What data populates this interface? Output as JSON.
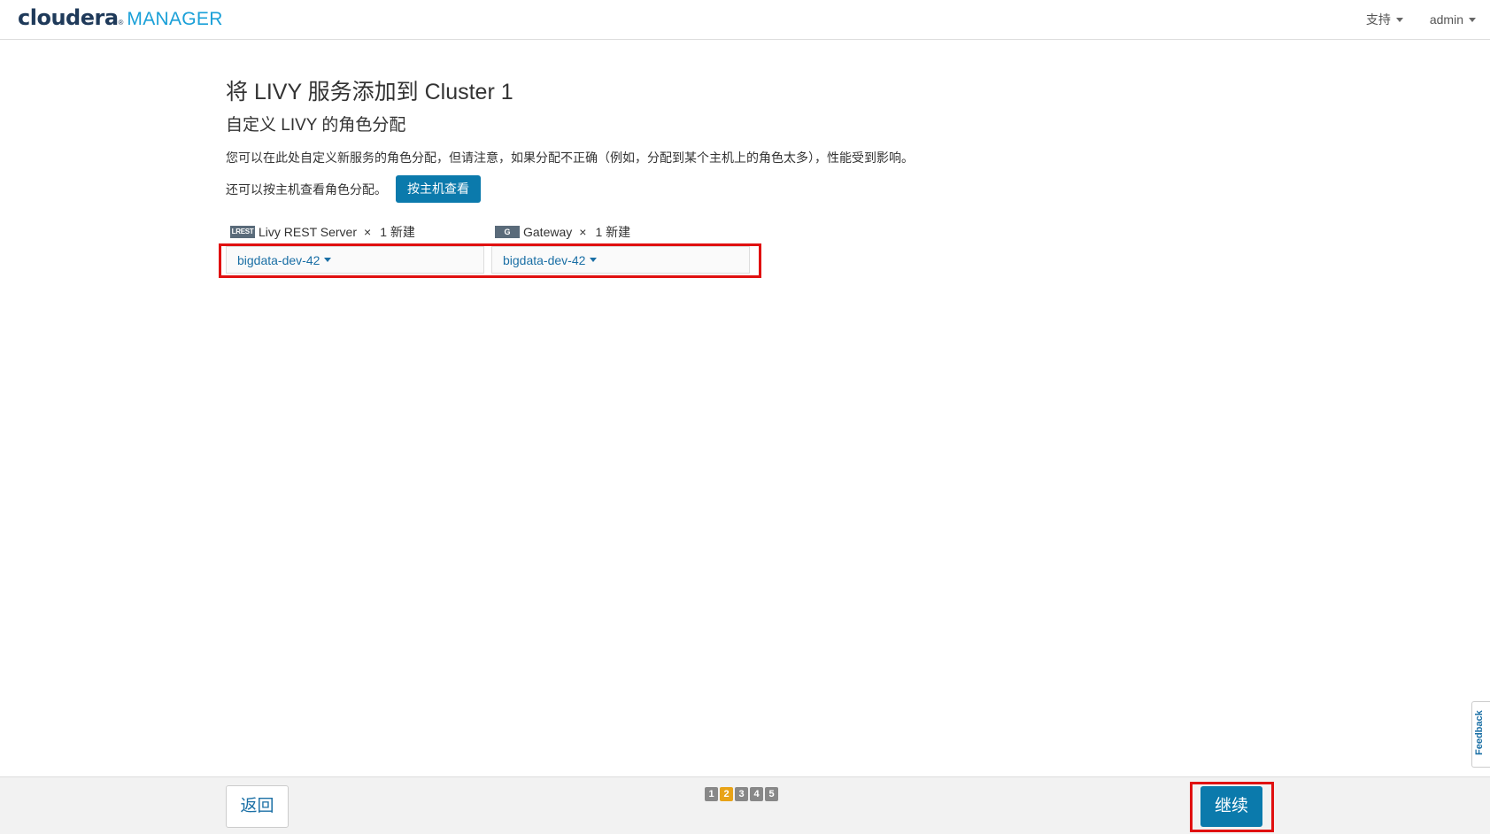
{
  "brand": {
    "name_main": "cloudera",
    "name_suffix": "MANAGER",
    "reg": "®"
  },
  "topnav": {
    "support_label": "支持",
    "user_label": "admin"
  },
  "page": {
    "title": "将 LIVY 服务添加到 Cluster 1",
    "subtitle": "自定义 LIVY 的角色分配",
    "description": "您可以在此处自定义新服务的角色分配，但请注意，如果分配不正确（例如，分配到某个主机上的角色太多），性能受到影响。",
    "host_view_text": "还可以按主机查看角色分配。",
    "host_view_button": "按主机查看"
  },
  "roles": [
    {
      "icon_label": "LREST",
      "icon_name": "livy-rest-server-icon",
      "name": "Livy REST Server",
      "multiplier": "×",
      "count": "1 新建",
      "host": "bigdata-dev-42"
    },
    {
      "icon_label": "G",
      "icon_name": "gateway-icon",
      "name": "Gateway",
      "multiplier": "×",
      "count": "1 新建",
      "host": "bigdata-dev-42"
    }
  ],
  "footer": {
    "back_label": "返回",
    "continue_label": "继续",
    "steps": [
      "1",
      "2",
      "3",
      "4",
      "5"
    ],
    "active_step": "2"
  },
  "feedback_label": "Feedback",
  "colors": {
    "primary": "#0b7aac",
    "highlight": "#e01010",
    "active_step": "#e8a317"
  }
}
